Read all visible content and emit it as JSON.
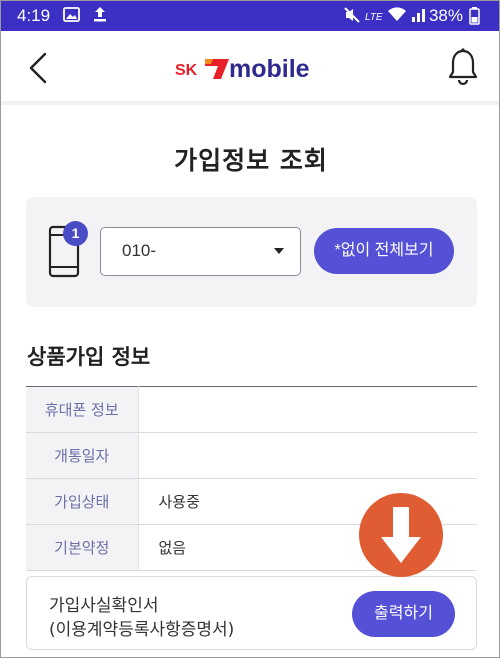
{
  "status_bar": {
    "time": "4:19",
    "battery_percent": "38%",
    "icons": [
      "image-icon",
      "upload-icon",
      "mute-icon",
      "lte-icon",
      "wifi-icon",
      "signal-icon"
    ],
    "background": "#3b2fc4"
  },
  "header": {
    "logo_sk": "SK",
    "logo_text": "mobile",
    "brand_red": "#e8202a",
    "brand_navy": "#2f2a8e"
  },
  "page": {
    "title": "가입정보 조회"
  },
  "lookup": {
    "line_count": "1",
    "selected_number": "010-",
    "view_all_label": "*없이 전체보기"
  },
  "product_info": {
    "section_title": "상품가입 정보",
    "rows": [
      {
        "label": "휴대폰 정보",
        "value": ""
      },
      {
        "label": "개통일자",
        "value": ""
      },
      {
        "label": "가입상태",
        "value": "사용중"
      },
      {
        "label": "기본약정",
        "value": "없음"
      }
    ]
  },
  "certificate": {
    "line1": "가입사실확인서",
    "line2": "(이용계약등록사항증명서)",
    "print_label": "출력하기"
  },
  "accent": "#5451d6",
  "overlay_color": "#e05d34"
}
